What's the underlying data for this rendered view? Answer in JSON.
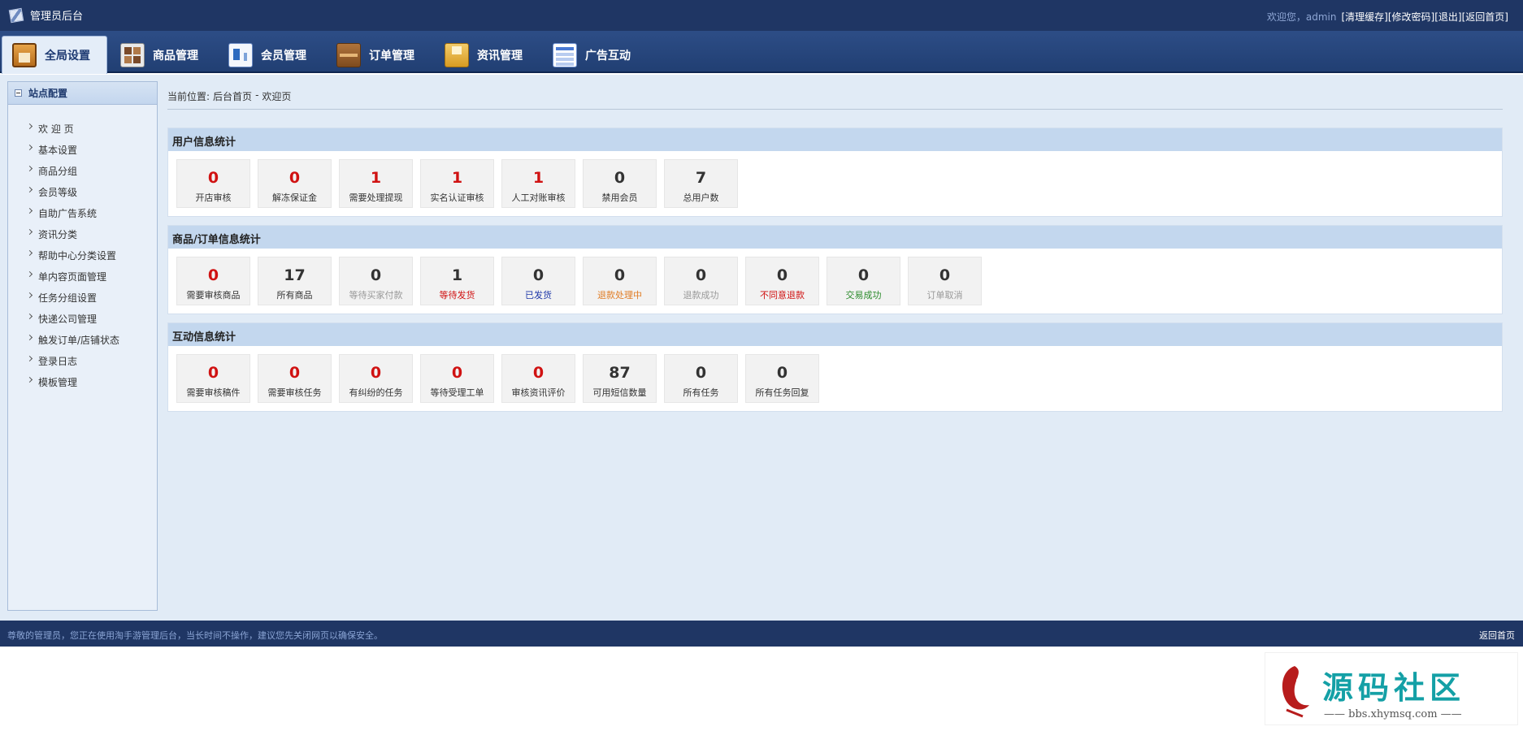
{
  "header": {
    "title": "管理员后台",
    "welcome": "欢迎您，admin",
    "links": [
      "[清理缓存]",
      "[修改密码]",
      "[退出]",
      "[返回首页]"
    ]
  },
  "nav": {
    "tabs": [
      {
        "label": "全局设置",
        "active": true
      },
      {
        "label": "商品管理"
      },
      {
        "label": "会员管理"
      },
      {
        "label": "订单管理"
      },
      {
        "label": "资讯管理"
      },
      {
        "label": "广告互动"
      }
    ]
  },
  "sidebar": {
    "title": "站点配置",
    "items": [
      "欢 迎 页",
      "基本设置",
      "商品分组",
      "会员等级",
      "自助广告系统",
      "资讯分类",
      "帮助中心分类设置",
      "单内容页面管理",
      "任务分组设置",
      "快递公司管理",
      "触发订单/店铺状态",
      "登录日志",
      "模板管理"
    ]
  },
  "breadcrumb": {
    "prefix": "当前位置:",
    "home": "后台首页",
    "sep": "-",
    "current": "欢迎页"
  },
  "sections": [
    {
      "title": "用户信息统计",
      "cards": [
        {
          "value": "0",
          "label": "开店审核",
          "valueColor": "#d01212",
          "labelColor": "#333333"
        },
        {
          "value": "0",
          "label": "解冻保证金",
          "valueColor": "#d01212",
          "labelColor": "#333333"
        },
        {
          "value": "1",
          "label": "需要处理提现",
          "valueColor": "#d01212",
          "labelColor": "#333333"
        },
        {
          "value": "1",
          "label": "实名认证审核",
          "valueColor": "#d01212",
          "labelColor": "#333333"
        },
        {
          "value": "1",
          "label": "人工对账审核",
          "valueColor": "#d01212",
          "labelColor": "#333333"
        },
        {
          "value": "0",
          "label": "禁用会员",
          "valueColor": "#333333",
          "labelColor": "#333333"
        },
        {
          "value": "7",
          "label": "总用户数",
          "valueColor": "#333333",
          "labelColor": "#333333"
        }
      ]
    },
    {
      "title": "商品/订单信息统计",
      "cards": [
        {
          "value": "0",
          "label": "需要审核商品",
          "valueColor": "#d01212",
          "labelColor": "#333333"
        },
        {
          "value": "17",
          "label": "所有商品",
          "valueColor": "#333333",
          "labelColor": "#333333"
        },
        {
          "value": "0",
          "label": "等待买家付款",
          "valueColor": "#333333",
          "labelColor": "#999999"
        },
        {
          "value": "1",
          "label": "等待发货",
          "valueColor": "#333333",
          "labelColor": "#d01212"
        },
        {
          "value": "0",
          "label": "已发货",
          "valueColor": "#333333",
          "labelColor": "#1d37a8"
        },
        {
          "value": "0",
          "label": "退款处理中",
          "valueColor": "#333333",
          "labelColor": "#e07c24"
        },
        {
          "value": "0",
          "label": "退款成功",
          "valueColor": "#333333",
          "labelColor": "#999999"
        },
        {
          "value": "0",
          "label": "不同意退款",
          "valueColor": "#333333",
          "labelColor": "#d01212"
        },
        {
          "value": "0",
          "label": "交易成功",
          "valueColor": "#333333",
          "labelColor": "#2a8a2a"
        },
        {
          "value": "0",
          "label": "订单取消",
          "valueColor": "#333333",
          "labelColor": "#999999"
        }
      ]
    },
    {
      "title": "互动信息统计",
      "cards": [
        {
          "value": "0",
          "label": "需要审核稿件",
          "valueColor": "#d01212",
          "labelColor": "#333333"
        },
        {
          "value": "0",
          "label": "需要审核任务",
          "valueColor": "#d01212",
          "labelColor": "#333333"
        },
        {
          "value": "0",
          "label": "有纠纷的任务",
          "valueColor": "#d01212",
          "labelColor": "#333333"
        },
        {
          "value": "0",
          "label": "等待受理工单",
          "valueColor": "#d01212",
          "labelColor": "#333333"
        },
        {
          "value": "0",
          "label": "审核资讯评价",
          "valueColor": "#d01212",
          "labelColor": "#333333"
        },
        {
          "value": "87",
          "label": "可用短信数量",
          "valueColor": "#333333",
          "labelColor": "#333333"
        },
        {
          "value": "0",
          "label": "所有任务",
          "valueColor": "#333333",
          "labelColor": "#333333"
        },
        {
          "value": "0",
          "label": "所有任务回复",
          "valueColor": "#333333",
          "labelColor": "#333333"
        }
      ]
    }
  ],
  "footer": {
    "message": "尊敬的管理员，您正在使用淘手游管理后台，当长时间不操作，建议您先关闭网页以确保安全。",
    "back": "返回首页"
  },
  "watermark": {
    "seal": "小",
    "title": "源码社区",
    "url": "—— bbs.xhymsq.com ——"
  },
  "colors": {
    "header_bg": "#1f3664",
    "content_bg": "#e1ebf6",
    "section_head_bg": "#c3d7ee",
    "accent_red": "#d01212"
  }
}
